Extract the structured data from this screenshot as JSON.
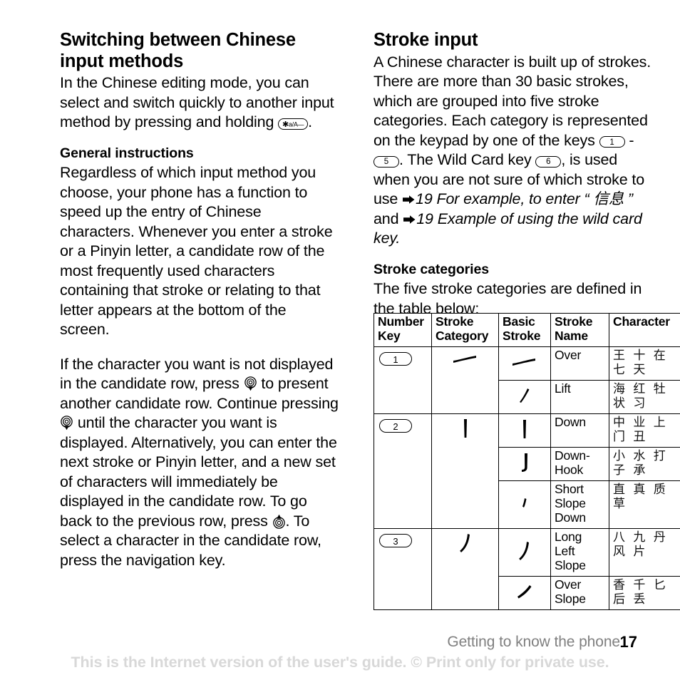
{
  "left_column": {
    "heading_1": "Switching between Chinese input methods",
    "para_1_before_key": "In the Chinese editing mode, you can select and switch quickly to another input method by pressing and holding ",
    "star_key_label": "a/A",
    "para_1_after_key": ".",
    "heading_2": "General instructions",
    "para_2": "Regardless of which input method you choose, your phone has a function to speed up the entry of Chinese characters. Whenever you enter a stroke or a Pinyin letter, a candidate row of the most frequently used characters containing that stroke or relating to that letter appears at the bottom of the screen.",
    "para_3_seg_1": "If the character you want is not displayed in the candidate row, press ",
    "para_3_seg_2": " to present another candidate row. Continue pressing ",
    "para_3_seg_3": " until the character you want is displayed. Alternatively, you can enter the next stroke or Pinyin letter, and a new set of characters will immediately be displayed in the candidate row. To go back to the previous row, press ",
    "para_3_seg_4": ". To select a character in the candidate row, press the navigation key."
  },
  "right_column": {
    "heading_1": "Stroke input",
    "para_1_seg_1": "A Chinese character is built up of strokes. There are more than 30 basic strokes, which are grouped into five stroke categories. Each category is represented on the keypad by one of the keys ",
    "key_1": "1",
    "para_1_seg_2": " - ",
    "key_5": "5",
    "para_1_seg_3": ". The Wild Card key ",
    "key_6": "6",
    "para_1_seg_4": ", is used when you are not sure of which stroke to use ",
    "xref_1": "19 For example, to enter “ ",
    "xref_1_cjk": "信息",
    "xref_1_tail": " ”",
    "para_1_seg_5": " and ",
    "xref_2": "19 Example of using the wild card key",
    "para_1_end": ".",
    "heading_2": "Stroke categories",
    "para_2": "The five stroke categories are defined in the table below:"
  },
  "table": {
    "headers": [
      "Number Key",
      "Stroke Category",
      "Basic Stroke",
      "Stroke Name",
      "Character"
    ],
    "groups": [
      {
        "number_key": "1",
        "category_stroke": "over",
        "rows": [
          {
            "basic_stroke": "over",
            "stroke_name": "Over",
            "characters": [
              "王",
              "十",
              "在",
              "七",
              "天"
            ]
          },
          {
            "basic_stroke": "lift",
            "stroke_name": "Lift",
            "characters": [
              "海",
              "红",
              "牡",
              "状",
              "习"
            ]
          }
        ]
      },
      {
        "number_key": "2",
        "category_stroke": "down",
        "rows": [
          {
            "basic_stroke": "down",
            "stroke_name": "Down",
            "characters": [
              "中",
              "业",
              "上",
              "门",
              "丑"
            ]
          },
          {
            "basic_stroke": "down-hook",
            "stroke_name": "Down-Hook",
            "characters": [
              "小",
              "水",
              "打",
              "子",
              "承"
            ]
          },
          {
            "basic_stroke": "short-slope",
            "stroke_name": "Short Slope Down",
            "characters": [
              "直",
              "真",
              "质",
              "草"
            ]
          }
        ]
      },
      {
        "number_key": "3",
        "category_stroke": "left-slope",
        "rows": [
          {
            "basic_stroke": "left-slope",
            "stroke_name": "Long Left Slope",
            "characters": [
              "八",
              "九",
              "丹",
              "风",
              "片"
            ]
          },
          {
            "basic_stroke": "over-slope",
            "stroke_name": "Over Slope",
            "characters": [
              "香",
              "千",
              "匕",
              "后",
              "丢"
            ]
          }
        ]
      }
    ]
  },
  "footer": {
    "running_title": "Getting to know the phone",
    "page_number": "17",
    "watermark": "This is the Internet version of the user's guide. © Print only for private use."
  }
}
